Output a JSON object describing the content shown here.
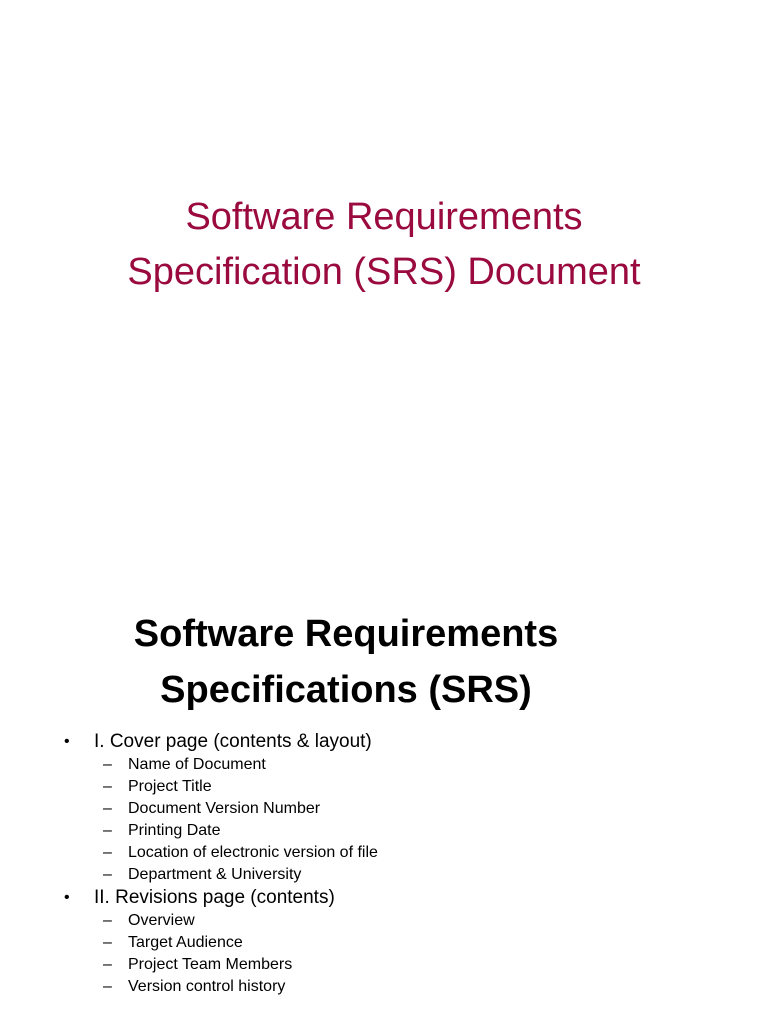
{
  "colors": {
    "title_accent": "#9A0A3E",
    "text": "#000000",
    "background": "#FFFFFF"
  },
  "slide1": {
    "title_lines": [
      "Software Requirements",
      "Specification (SRS) Document"
    ]
  },
  "slide2": {
    "title_lines": [
      "Software Requirements",
      "Specifications (SRS)"
    ],
    "bullet_glyph": "•",
    "dash_glyph": "–",
    "sections": [
      {
        "label": "I. Cover page (contents & layout)",
        "items": [
          "Name of Document",
          "Project Title",
          "Document Version Number",
          "Printing Date",
          "Location of electronic version of file",
          "Department & University"
        ]
      },
      {
        "label": "II. Revisions page (contents)",
        "items": [
          "Overview",
          "Target Audience",
          "Project Team Members",
          "Version control history"
        ]
      }
    ]
  }
}
